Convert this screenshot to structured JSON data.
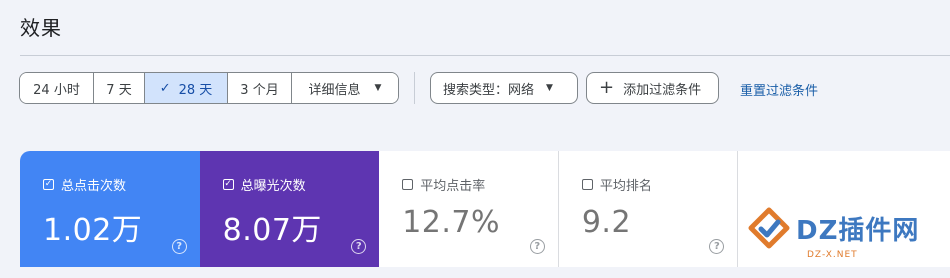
{
  "header": {
    "title": "效果"
  },
  "date_range": {
    "options": [
      "24 小时",
      "7 天",
      "28 天",
      "3 个月"
    ],
    "selected_index": 2,
    "details_label": "详细信息"
  },
  "filters": {
    "search_type_label": "搜索类型：网络",
    "add_filter_label": "添加过滤条件",
    "reset_label": "重置过滤条件"
  },
  "metrics": [
    {
      "label": "总点击次数",
      "value": "1.02万",
      "checked": true,
      "color": "#4285f4"
    },
    {
      "label": "总曝光次数",
      "value": "8.07万",
      "checked": true,
      "color": "#5e35b1"
    },
    {
      "label": "平均点击率",
      "value": "12.7%",
      "checked": false
    },
    {
      "label": "平均排名",
      "value": "9.2",
      "checked": false
    }
  ],
  "watermark": {
    "brand": "DZ插件网",
    "sub": "DZ-X.NET"
  },
  "icons": {
    "check": "check-icon",
    "caret": "caret-down-icon",
    "add": "add-icon",
    "help": "help-icon"
  }
}
